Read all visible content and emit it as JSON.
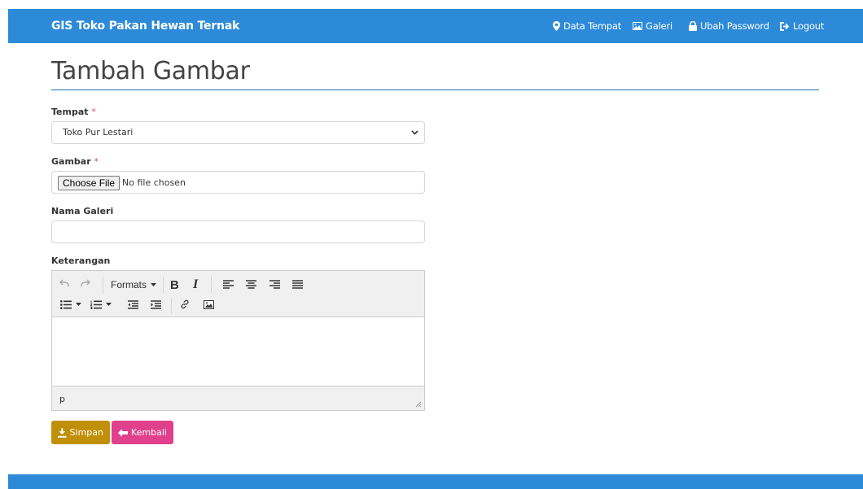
{
  "app": {
    "brand": "GIS Toko Pakan Hewan Ternak"
  },
  "nav": {
    "items": [
      {
        "label": "Data Tempat",
        "icon": "map-marker-icon"
      },
      {
        "label": "Galeri",
        "icon": "picture-icon"
      },
      {
        "label": "Ubah Password",
        "icon": "lock-icon"
      },
      {
        "label": "Logout",
        "icon": "logout-icon"
      }
    ]
  },
  "page": {
    "title": "Tambah Gambar"
  },
  "form": {
    "tempat": {
      "label": "Tempat",
      "required_mark": "*",
      "value": "Toko Pur Lestari"
    },
    "gambar": {
      "label": "Gambar",
      "required_mark": "*",
      "button": "Choose File",
      "status": "No file chosen"
    },
    "nama_galeri": {
      "label": "Nama Galeri",
      "value": "",
      "placeholder": ""
    },
    "keterangan": {
      "label": "Keterangan",
      "toolbar": {
        "formats_label": "Formats",
        "bold_label": "B",
        "italic_label": "I",
        "icons": [
          "undo-icon",
          "redo-icon",
          "align-left-icon",
          "align-center-icon",
          "align-right-icon",
          "align-justify-icon",
          "bullet-list-icon",
          "numbered-list-icon",
          "outdent-icon",
          "indent-icon",
          "link-icon",
          "image-icon"
        ]
      },
      "status_path": "p"
    }
  },
  "actions": {
    "save_label": "Simpan",
    "back_label": "Kembali"
  },
  "colors": {
    "navbar": "#2d8ad8",
    "save": "#c0900a",
    "back": "#e0408c",
    "required": "#d9534f"
  }
}
